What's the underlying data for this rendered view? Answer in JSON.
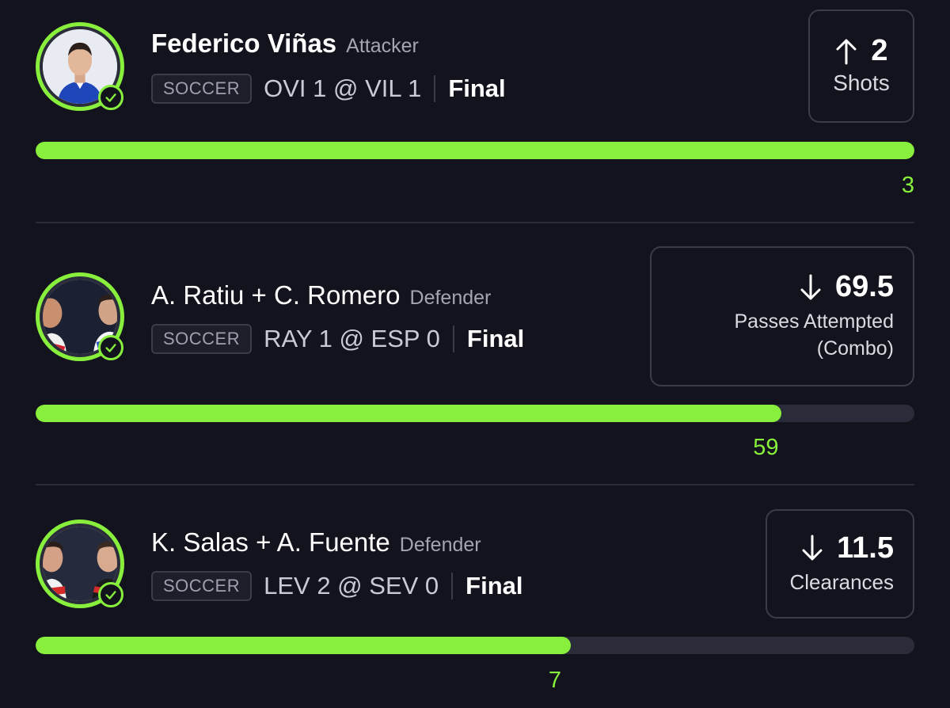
{
  "colors": {
    "accent": "#88f03c",
    "background": "#13131d",
    "track": "#2b2c39"
  },
  "picks": [
    {
      "player": "Federico Viñas",
      "position": "Attacker",
      "sport": "SOCCER",
      "matchup": "OVI 1 @ VIL 1",
      "status": "Final",
      "direction": "up",
      "line": "2",
      "stat": "Shots",
      "actual": "3",
      "progress": 1.0
    },
    {
      "player": "A. Ratiu + C. Romero",
      "position": "Defender",
      "sport": "SOCCER",
      "matchup": "RAY 1 @ ESP 0",
      "status": "Final",
      "direction": "down",
      "line": "69.5",
      "stat": "Passes Attempted",
      "stat_sub": "(Combo)",
      "actual": "59",
      "progress": 0.849
    },
    {
      "player": "K. Salas + A. Fuente",
      "position": "Defender",
      "sport": "SOCCER",
      "matchup": "LEV 2 @ SEV 0",
      "status": "Final",
      "direction": "down",
      "line": "11.5",
      "stat": "Clearances",
      "actual": "7",
      "progress": 0.609
    }
  ]
}
